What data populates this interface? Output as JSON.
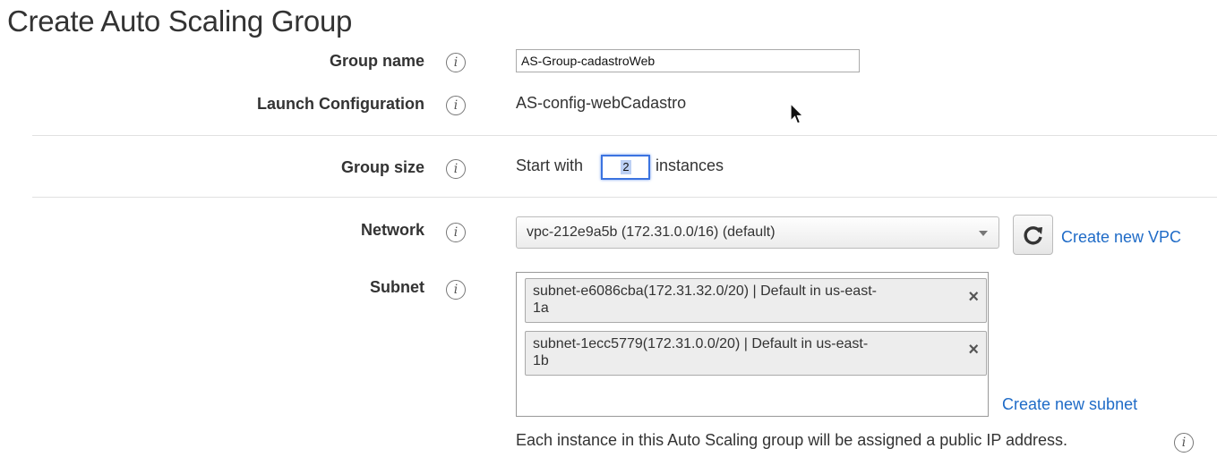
{
  "page": {
    "title": "Create Auto Scaling Group"
  },
  "form": {
    "group_name": {
      "label": "Group name",
      "value": "AS-Group-cadastroWeb"
    },
    "launch_configuration": {
      "label": "Launch Configuration",
      "value": "AS-config-webCadastro"
    },
    "group_size": {
      "label": "Group size",
      "prefix": "Start with",
      "value": "2",
      "suffix": "instances"
    },
    "network": {
      "label": "Network",
      "selected": "vpc-212e9a5b (172.31.0.0/16) (default)",
      "create_link": "Create new VPC"
    },
    "subnet": {
      "label": "Subnet",
      "items": [
        {
          "line1": "subnet-e6086cba(172.31.32.0/20) | Default in us-east-",
          "line2": "1a"
        },
        {
          "line1": "subnet-1ecc5779(172.31.0.0/20) | Default in us-east-",
          "line2": "1b"
        }
      ],
      "create_link": "Create new subnet",
      "note": "Each instance in this Auto Scaling group will be assigned a public IP address."
    }
  },
  "icons": {
    "info": "info-icon",
    "refresh": "refresh-icon",
    "close": "close-icon",
    "cursor": "mouse-cursor-icon",
    "caret": "chevron-down-icon"
  },
  "colors": {
    "link": "#1f6bc7",
    "focus": "#3b73e0"
  }
}
